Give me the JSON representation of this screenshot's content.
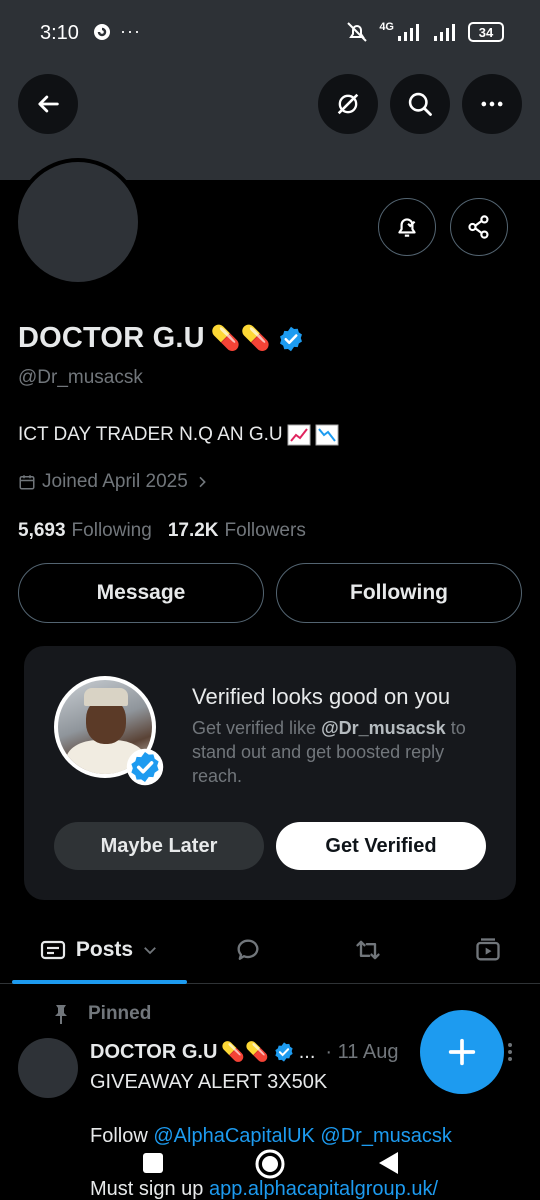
{
  "status_bar": {
    "time": "3:10",
    "overflow": "···",
    "network": "4G",
    "battery": "34"
  },
  "profile": {
    "name": "DOCTOR G.U",
    "name_emoji": "💊💊",
    "handle": "@Dr_musacsk",
    "bio": "ICT DAY TRADER N.Q AN G.U",
    "joined": "Joined April 2025",
    "following_count": "5,693",
    "following_label": "Following",
    "followers_count": "17.2K",
    "followers_label": "Followers"
  },
  "actions": {
    "message": "Message",
    "following": "Following"
  },
  "promo": {
    "title": "Verified looks good on you",
    "body_prefix": "Get verified like ",
    "body_handle": "@Dr_musacsk",
    "body_suffix": "to stand out and get boosted reply reach.",
    "maybe_later": "Maybe Later",
    "get_verified": "Get Verified"
  },
  "tabs": {
    "posts": "Posts"
  },
  "post": {
    "pinned_label": "Pinned",
    "author": "DOCTOR G.U",
    "author_emoji": "💊💊",
    "ellipsis": "...",
    "date": "· 11 Aug",
    "line1": "GIVEAWAY ALERT 3X50K",
    "follow_prefix": "Follow",
    "mention1": "@AlphaCapitalUK",
    "mention2": "@Dr_musacsk",
    "signup_prefix": "Must sign up",
    "signup_link": "app.alphacapitalgroup.uk/"
  },
  "colors": {
    "accent": "#1d9bf0",
    "background": "#000000",
    "muted": "#71767b"
  }
}
